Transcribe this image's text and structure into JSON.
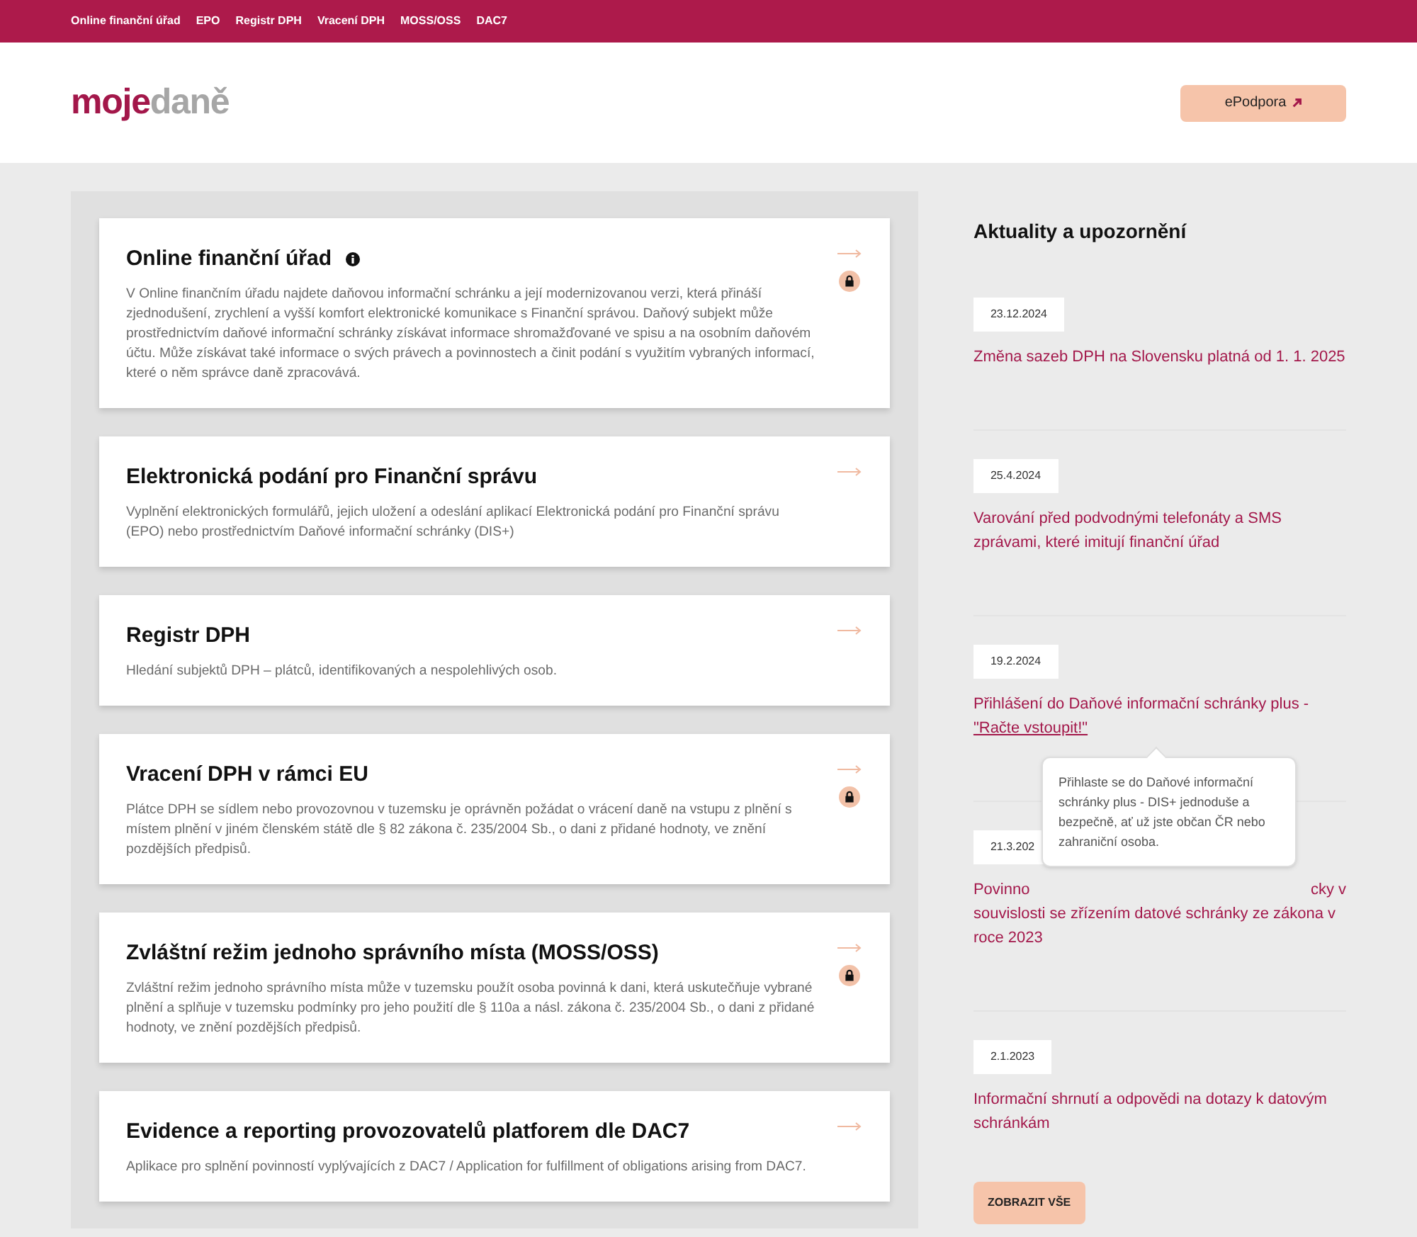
{
  "top_nav": [
    "Online finanční úřad",
    "EPO",
    "Registr DPH",
    "Vracení DPH",
    "MOSS/OSS",
    "DAC7"
  ],
  "logo": {
    "part_1": "moje",
    "part_2": "daně"
  },
  "support_button": {
    "label": "ePodpora"
  },
  "cards": [
    {
      "title": "Online finanční úřad",
      "info": true,
      "locked": true,
      "description": "V Online finančním úřadu najdete daňovou informační schránku a její modernizovanou verzi, která přináší zjednodušení, zrychlení a vyšší komfort elektronické komunikace s Finanční správou. Daňový subjekt může prostřednictvím daňové informační schránky získávat informace shromažďované ve spisu a na osobním daňovém účtu. Může získávat také informace o svých právech a povinnostech a činit podání s využitím vybraných informací, které o něm správce daně zpracovává."
    },
    {
      "title": "Elektronická podání pro Finanční správu",
      "info": false,
      "locked": false,
      "description": "Vyplnění elektronických formulářů, jejich uložení a odeslání aplikací Elektronická podání pro Finanční správu (EPO) nebo prostřednictvím Daňové informační schránky (DIS+)"
    },
    {
      "title": "Registr DPH",
      "info": false,
      "locked": false,
      "description": "Hledání subjektů DPH – plátců, identifikovaných a nespolehlivých osob."
    },
    {
      "title": "Vracení DPH v rámci EU",
      "info": false,
      "locked": true,
      "description": "Plátce DPH se sídlem nebo provozovnou v tuzemsku je oprávněn požádat o vrácení daně na vstupu z plnění s místem plnění v jiném členském státě dle § 82 zákona č. 235/2004 Sb., o dani z přidané hodnoty, ve znění pozdějších předpisů."
    },
    {
      "title": "Zvláštní režim jednoho správního místa (MOSS/OSS)",
      "info": false,
      "locked": true,
      "description": "Zvláštní režim jednoho správního místa může v tuzemsku použít osoba povinná k dani, která uskutečňuje vybrané plnění a splňuje v tuzemsku podmínky pro jeho použití dle § 110a a násl. zákona č. 235/2004 Sb., o dani z přidané hodnoty, ve znění pozdějších předpisů."
    },
    {
      "title": "Evidence a reporting provozovatelů platforem dle DAC7",
      "info": false,
      "locked": false,
      "description": "Aplikace pro splnění povinností vyplývajících z DAC7 / Application for fulfillment of obligations arising from DAC7."
    }
  ],
  "news": {
    "heading": "Aktuality a upozornění",
    "items": [
      {
        "date": "23.12.2024",
        "title": "Změna sazeb DPH na Slovensku platná od 1. 1. 2025"
      },
      {
        "date": "25.4.2024",
        "title": "Varování před podvodnými telefonáty a SMS zprávami, které imitují finanční úřad"
      },
      {
        "date": "19.2.2024",
        "title": "Přihlášení do Daňové informační schránky plus -",
        "link": "\"Račte vstoupit!\"",
        "tooltip": "Přihlaste se do Daňové informační schránky plus - DIS+ jednoduše a bezpečně, ať už jste občan ČR nebo zahraniční osoba."
      },
      {
        "date": "21.3.202",
        "title_start": "Povinno",
        "title_end": "cky v",
        "title": "souvislosti se zřízením datové schránky ze zákona v roce 2023"
      },
      {
        "date": "2.1.2023",
        "title": "Informační shrnutí a odpovědi na dotazy k datovým schránkám"
      }
    ],
    "show_all": "ZOBRAZIT VŠE"
  }
}
